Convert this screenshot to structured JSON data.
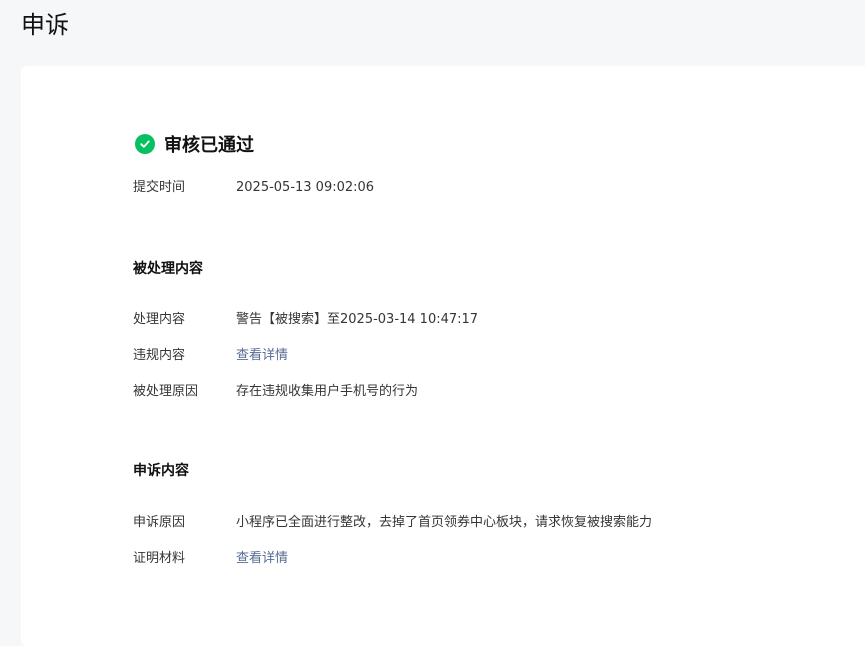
{
  "page": {
    "title": "申诉"
  },
  "status": {
    "text": "审核已通过"
  },
  "submit": {
    "label": "提交时间",
    "value": "2025-05-13 09:02:06"
  },
  "handled_section": {
    "title": "被处理内容",
    "rows": [
      {
        "label": "处理内容",
        "value": "警告【被搜索】至2025-03-14 10:47:17"
      },
      {
        "label": "违规内容",
        "value": "查看详情"
      },
      {
        "label": "被处理原因",
        "value": "存在违规收集用户手机号的行为"
      }
    ]
  },
  "appeal_section": {
    "title": "申诉内容",
    "rows": [
      {
        "label": "申诉原因",
        "value": "小程序已全面进行整改，去掉了首页领券中心板块，请求恢复被搜索能力"
      },
      {
        "label": "证明材料",
        "value": "查看详情"
      }
    ]
  },
  "colors": {
    "success": "#07c160",
    "link": "#576b95",
    "background": "#f6f7f9",
    "card": "#ffffff"
  },
  "icons": {
    "status_icon": "check-circle-icon"
  }
}
